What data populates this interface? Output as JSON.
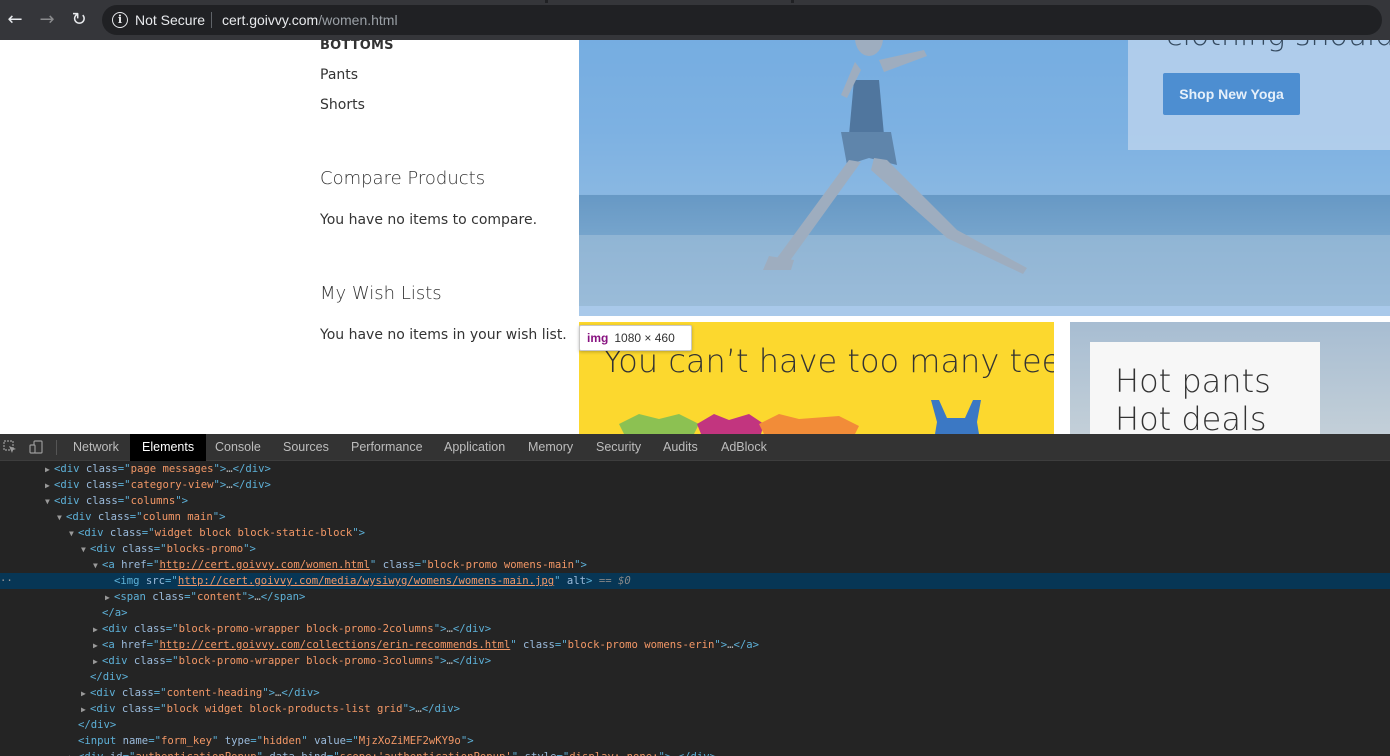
{
  "browser": {
    "security_label": "Not Secure",
    "url_host": "cert.goivvy.com",
    "url_path": "/women.html"
  },
  "sidebar": {
    "bottoms_heading": "BOTTOMS",
    "links": [
      "Pants",
      "Shorts"
    ],
    "compare_title": "Compare Products",
    "compare_text": "You have no items to compare.",
    "wishlist_title": "My Wish Lists",
    "wishlist_text": "You have no items in your wish list."
  },
  "hero": {
    "headline_partial": "clothing should",
    "button_label": "Shop New Yoga"
  },
  "tooltip": {
    "tag": "img",
    "size": "1080 × 460"
  },
  "promos": {
    "tees_text": "You can’t have too many tees",
    "pants_line1": "Hot pants",
    "pants_line2": "Hot deals"
  },
  "devtools": {
    "tabs": [
      "Network",
      "Elements",
      "Console",
      "Sources",
      "Performance",
      "Application",
      "Memory",
      "Security",
      "Audits",
      "AdBlock"
    ],
    "active_tab": "Elements",
    "selected_marker": "== $0",
    "dom_lines": [
      {
        "indent": 0,
        "tri": "▶",
        "open": "div",
        "attrs": [
          [
            "class",
            "page messages"
          ]
        ],
        "collapsed": true
      },
      {
        "indent": 0,
        "tri": "▶",
        "open": "div",
        "attrs": [
          [
            "class",
            "category-view"
          ]
        ],
        "collapsed": true
      },
      {
        "indent": 0,
        "tri": "▼",
        "open": "div",
        "attrs": [
          [
            "class",
            "columns"
          ]
        ]
      },
      {
        "indent": 1,
        "tri": "▼",
        "open": "div",
        "attrs": [
          [
            "class",
            "column main"
          ]
        ]
      },
      {
        "indent": 2,
        "tri": "▼",
        "open": "div",
        "attrs": [
          [
            "class",
            "widget block block-static-block"
          ]
        ]
      },
      {
        "indent": 3,
        "tri": "▼",
        "open": "div",
        "attrs": [
          [
            "class",
            "blocks-promo"
          ]
        ]
      },
      {
        "indent": 4,
        "tri": "▼",
        "open": "a",
        "attrs": [
          [
            "href",
            "http://cert.goivvy.com/women.html",
            "link"
          ],
          [
            "class",
            "block-promo womens-main"
          ]
        ]
      },
      {
        "indent": 5,
        "tri": "",
        "open": "img",
        "attrs": [
          [
            "src",
            "http://cert.goivvy.com/media/wysiwyg/womens/womens-main.jpg",
            "link"
          ],
          [
            "alt"
          ]
        ],
        "selected": true
      },
      {
        "indent": 5,
        "tri": "▶",
        "open": "span",
        "attrs": [
          [
            "class",
            "content"
          ]
        ],
        "collapsed": true
      },
      {
        "indent": 4,
        "tri": "",
        "close": "a"
      },
      {
        "indent": 4,
        "tri": "▶",
        "open": "div",
        "attrs": [
          [
            "class",
            "block-promo-wrapper block-promo-2columns"
          ]
        ],
        "collapsed": true
      },
      {
        "indent": 4,
        "tri": "▶",
        "open": "a",
        "attrs": [
          [
            "href",
            "http://cert.goivvy.com/collections/erin-recommends.html",
            "link"
          ],
          [
            "class",
            "block-promo womens-erin"
          ]
        ],
        "collapsed": true
      },
      {
        "indent": 4,
        "tri": "▶",
        "open": "div",
        "attrs": [
          [
            "class",
            "block-promo-wrapper block-promo-3columns"
          ]
        ],
        "collapsed": true
      },
      {
        "indent": 3,
        "tri": "",
        "close": "div"
      },
      {
        "indent": 3,
        "tri": "▶",
        "open": "div",
        "attrs": [
          [
            "class",
            "content-heading"
          ]
        ],
        "collapsed": true
      },
      {
        "indent": 3,
        "tri": "▶",
        "open": "div",
        "attrs": [
          [
            "class",
            "block widget block-products-list grid"
          ]
        ],
        "collapsed": true
      },
      {
        "indent": 2,
        "tri": "",
        "close": "div"
      },
      {
        "indent": 2,
        "tri": "",
        "open": "input",
        "attrs": [
          [
            "name",
            "form_key"
          ],
          [
            "type",
            "hidden"
          ],
          [
            "value",
            "MjzXoZiMEF2wKY9o"
          ]
        ]
      },
      {
        "indent": 2,
        "tri": "▶",
        "open": "div",
        "attrs": [
          [
            "id",
            "authenticationPopup"
          ],
          [
            "data-bind",
            "scope:'authenticationPopup'"
          ],
          [
            "style",
            "display: none;"
          ]
        ],
        "collapsed": true
      }
    ]
  },
  "colors": {
    "devtools_bg": "#242424",
    "selected_row": "#073655",
    "tag": "#5db0d7",
    "attr_name": "#9bbbdc",
    "attr_value": "#f29766",
    "shop_button": "#4d8ed1",
    "tees_bg": "#fcd82e"
  }
}
